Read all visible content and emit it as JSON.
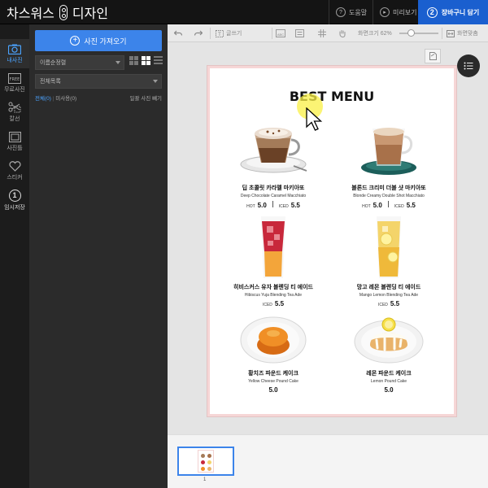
{
  "header": {
    "logo_left": "차스워스",
    "logo_right": "디자인",
    "help_label": "도움말",
    "preview_label": "미리보기",
    "cart_number": "2",
    "cart_label": "장바구니 담기"
  },
  "left_nav": [
    {
      "label": "내사진",
      "icon": "photo-icon"
    },
    {
      "label": "무료사진",
      "icon": "free-photo-icon"
    },
    {
      "label": "칼선",
      "icon": "scissors-icon"
    },
    {
      "label": "사진틀",
      "icon": "frame-icon"
    },
    {
      "label": "스티커",
      "icon": "heart-sticker-icon"
    },
    {
      "label": "임시저장",
      "icon": "save-number-icon",
      "number": "1"
    }
  ],
  "panel": {
    "upload_label": "사진 가져오기",
    "sort_value": "이름순정렬",
    "folder_value": "전체목록",
    "filter_all": "전체(0)",
    "filter_unused": "미사용(0)",
    "bulk_delete": "일괄 사진 빼기"
  },
  "toolbar": {
    "text_label": "글쓰기",
    "zoom_label": "화면크기 62%",
    "fit_label": "화면맞춤",
    "abc_label": "ABC"
  },
  "menu": {
    "title": "BEST MENU",
    "items": [
      {
        "kr": "딥 초콜릿 카라멜 마키아또",
        "en": "Deep Chocolate Caramel Macchiato",
        "hot_label": "HOT",
        "hot_price": "5.0",
        "iced_label": "ICED",
        "iced_price": "5.5"
      },
      {
        "kr": "블론드 크리미 더블 샷 마키아또",
        "en": "Blonde Creamy Double Shot Macchiato",
        "hot_label": "HOT",
        "hot_price": "5.0",
        "iced_label": "ICED",
        "iced_price": "5.5"
      },
      {
        "kr": "히비스커스 유자 블렌딩 티 에이드",
        "en": "Hibiscus Yuja Blending Tea Ade",
        "iced_label": "ICED",
        "iced_price": "5.5"
      },
      {
        "kr": "망고 레몬 블렌딩 티 에이드",
        "en": "Mango Lemon Blending Tea Ade",
        "iced_label": "ICED",
        "iced_price": "5.5"
      },
      {
        "kr": "황치즈 파운드 케이크",
        "en": "Yellow Cheese Pound Cake",
        "price": "5.0"
      },
      {
        "kr": "레몬 파운드 케이크",
        "en": "Lemon Pound Cake",
        "price": "5.0"
      }
    ]
  },
  "pages": {
    "current": "1"
  },
  "colors": {
    "accent": "#3c84ea",
    "cart": "#1a5fcf",
    "page_border": "#f6d6d6"
  }
}
